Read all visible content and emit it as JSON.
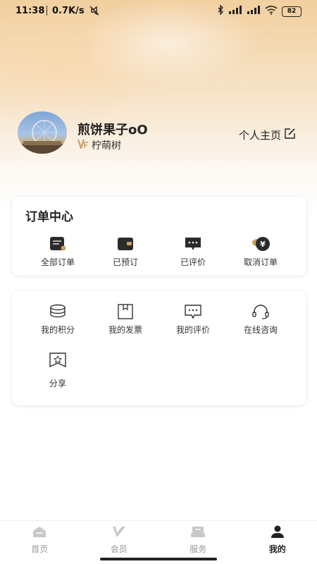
{
  "status_bar": {
    "time": "11:38",
    "speed": "0.7K/s",
    "battery": "82",
    "icons": [
      "mute-icon",
      "bluetooth-icon",
      "signal-icon",
      "signal-icon",
      "wifi-icon",
      "battery-icon"
    ]
  },
  "profile": {
    "nickname": "煎饼果子oO",
    "member_level": "柠萌树",
    "homepage_link": "个人主页",
    "edit_icon": "edit-icon"
  },
  "order_center": {
    "title": "订单中心",
    "items": [
      {
        "label": "全部订单",
        "icon": "all-orders-icon"
      },
      {
        "label": "已预订",
        "icon": "wallet-icon"
      },
      {
        "label": "已评价",
        "icon": "comment-icon"
      },
      {
        "label": "取消订单",
        "icon": "yen-icon"
      }
    ]
  },
  "services": {
    "items": [
      {
        "label": "我的积分",
        "icon": "coins-icon"
      },
      {
        "label": "我的发票",
        "icon": "invoice-icon"
      },
      {
        "label": "我的评价",
        "icon": "review-icon"
      },
      {
        "label": "在线咨询",
        "icon": "headset-icon"
      },
      {
        "label": "分享",
        "icon": "share-icon"
      }
    ]
  },
  "tab_bar": {
    "items": [
      {
        "label": "首页",
        "icon": "home-icon"
      },
      {
        "label": "会员",
        "icon": "member-icon"
      },
      {
        "label": "服务",
        "icon": "service-icon"
      },
      {
        "label": "我的",
        "icon": "user-icon"
      }
    ],
    "active": "我的"
  },
  "colors": {
    "accent": "#c9a063",
    "active_tab": "#222222",
    "inactive_tab": "#999999"
  }
}
